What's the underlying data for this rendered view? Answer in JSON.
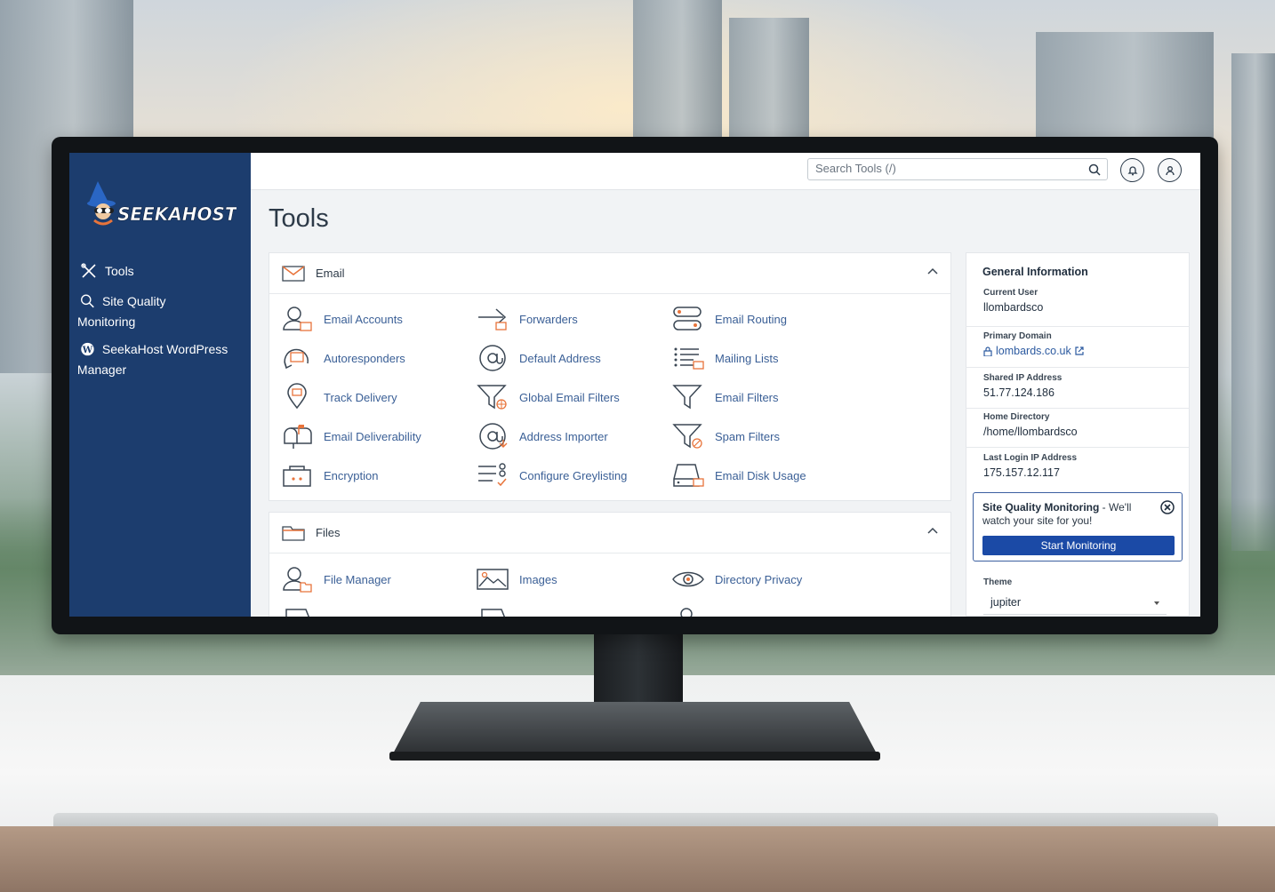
{
  "app": {
    "brand": "SEEKAHOST"
  },
  "sidebar": {
    "items": [
      {
        "label": "Tools",
        "icon": "tools-icon"
      },
      {
        "label": "Site Quality Monitoring",
        "icon": "magnifier-icon"
      },
      {
        "label": "SeekaHost WordPress Manager",
        "icon": "wordpress-icon"
      }
    ]
  },
  "topbar": {
    "search_placeholder": "Search Tools (/)"
  },
  "page": {
    "title": "Tools"
  },
  "sections": {
    "email": {
      "title": "Email",
      "tools": [
        "Email Accounts",
        "Forwarders",
        "Email Routing",
        "Autoresponders",
        "Default Address",
        "Mailing Lists",
        "Track Delivery",
        "Global Email Filters",
        "Email Filters",
        "Email Deliverability",
        "Address Importer",
        "Spam Filters",
        "Encryption",
        "Configure Greylisting",
        "Email Disk Usage"
      ]
    },
    "files": {
      "title": "Files",
      "tools": [
        "File Manager",
        "Images",
        "Directory Privacy"
      ]
    }
  },
  "general_info": {
    "title": "General Information",
    "current_user_label": "Current User",
    "current_user": "llombardsco",
    "primary_domain_label": "Primary Domain",
    "primary_domain": "lombards.co.uk",
    "shared_ip_label": "Shared IP Address",
    "shared_ip": "51.77.124.186",
    "home_dir_label": "Home Directory",
    "home_dir": "/home/llombardsco",
    "last_login_label": "Last Login IP Address",
    "last_login": "175.157.12.117"
  },
  "promo": {
    "title": "Site Quality Monitoring",
    "text": " - We'll watch your site for you!",
    "button": "Start Monitoring"
  },
  "theme": {
    "label": "Theme",
    "value": "jupiter"
  },
  "colors": {
    "sidebar": "#1c3d6e",
    "accent": "#1b4aa6",
    "link": "#3a5f96",
    "icon_orange": "#e8743b"
  }
}
